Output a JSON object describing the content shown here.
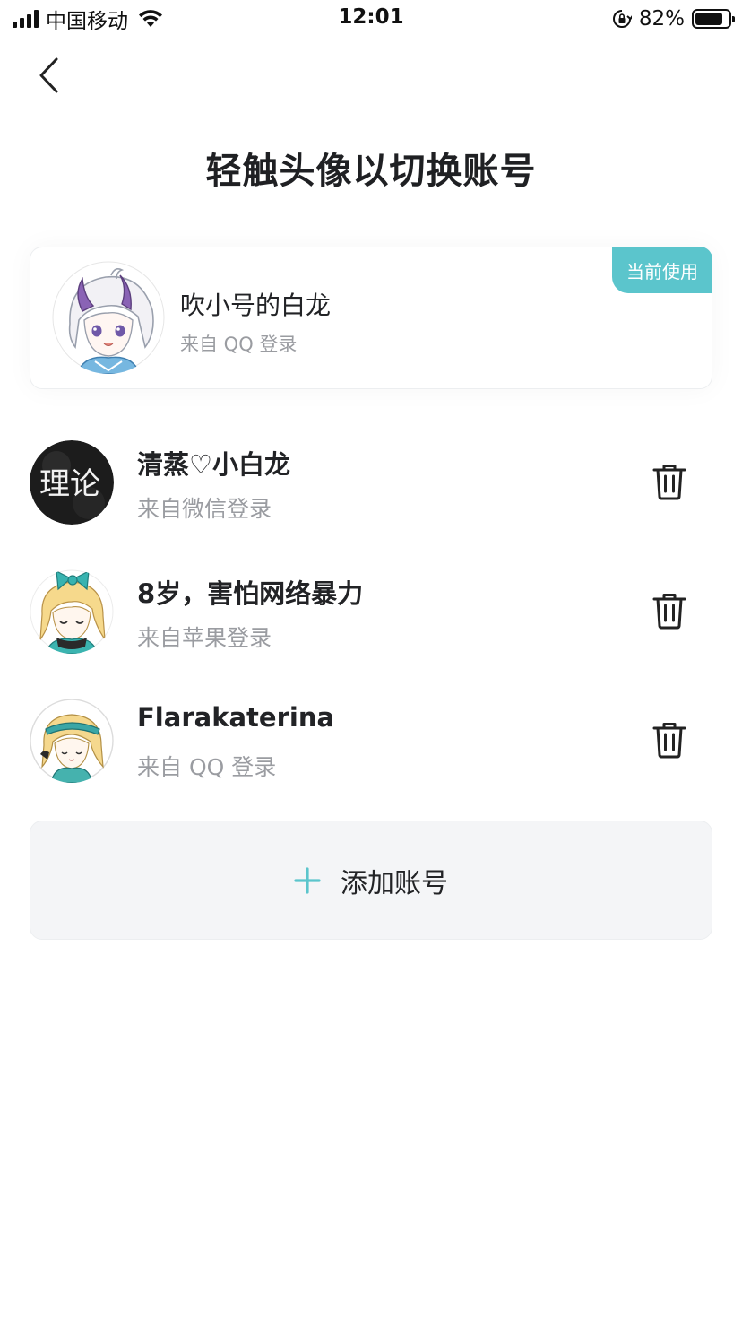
{
  "status_bar": {
    "carrier": "中国移动",
    "time": "12:01",
    "battery_percent": "82%",
    "battery_level": 0.82
  },
  "nav": {
    "back_icon": "chevron-left-icon"
  },
  "title": "轻触头像以切换账号",
  "current_account": {
    "badge": "当前使用",
    "name": "吹小号的白龙",
    "source": "来自 QQ 登录"
  },
  "accounts": [
    {
      "name": "清蒸♡小白龙",
      "source": "来自微信登录",
      "avatar_text": "理论"
    },
    {
      "name": "8岁，害怕网络暴力",
      "source": "来自苹果登录"
    },
    {
      "name": "Flarakaterina",
      "source": "来自 QQ 登录"
    }
  ],
  "add_account": {
    "label": "添加账号",
    "icon": "plus-icon"
  },
  "colors": {
    "accent": "#5bc5cc",
    "text_primary": "#222326",
    "text_secondary": "#9a9ca1",
    "add_bg": "#f4f5f7"
  }
}
